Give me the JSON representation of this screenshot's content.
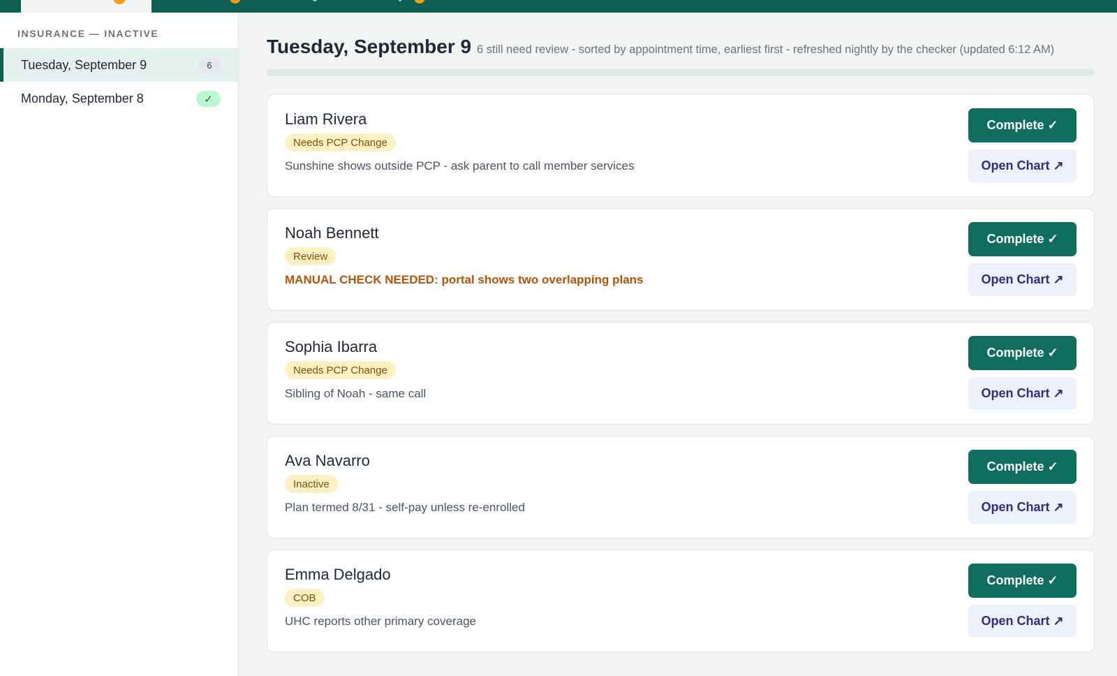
{
  "colors": {
    "brand": "#0f5e52",
    "complete_button": "#0f6e60",
    "chart_button_bg": "#eef0fb",
    "chart_button_text": "#312e81",
    "tag_bg": "#fdf0c2",
    "tag_text": "#854d0e",
    "alert_text": "#b45309",
    "tab_count_badge": "#f59e0b"
  },
  "sidebar": {
    "heading": "INSURANCE — INACTIVE",
    "days": [
      {
        "label": "Tuesday, September 9",
        "count": "6",
        "selected": true
      },
      {
        "label": "Monday, September 8",
        "done_icon": "✓",
        "selected": false
      }
    ]
  },
  "main": {
    "title": "Tuesday, September 9",
    "subtitle": "6 still need review - sorted by appointment time, earliest first - refreshed nightly by the checker (updated 6:12 AM)",
    "progress_fraction": 0,
    "cards": [
      {
        "name": "Liam Rivera",
        "tag": "Needs PCP Change",
        "note": "Sunshine shows outside PCP - ask parent to call member services",
        "alert": false
      },
      {
        "name": "Noah Bennett",
        "tag": "Review",
        "note": "MANUAL CHECK NEEDED: portal shows two overlapping plans",
        "alert": true
      },
      {
        "name": "Sophia Ibarra",
        "tag": "Needs PCP Change",
        "note": "Sibling of Noah - same call",
        "alert": false
      },
      {
        "name": "Ava Navarro",
        "tag": "Inactive",
        "note": "Plan termed 8/31 - self-pay unless re-enrolled",
        "alert": false
      },
      {
        "name": "Emma Delgado",
        "tag": "COB",
        "note": "UHC reports other primary coverage",
        "alert": false
      }
    ],
    "complete_label": "Complete ✓",
    "open_chart_label": "Open Chart ↗"
  }
}
